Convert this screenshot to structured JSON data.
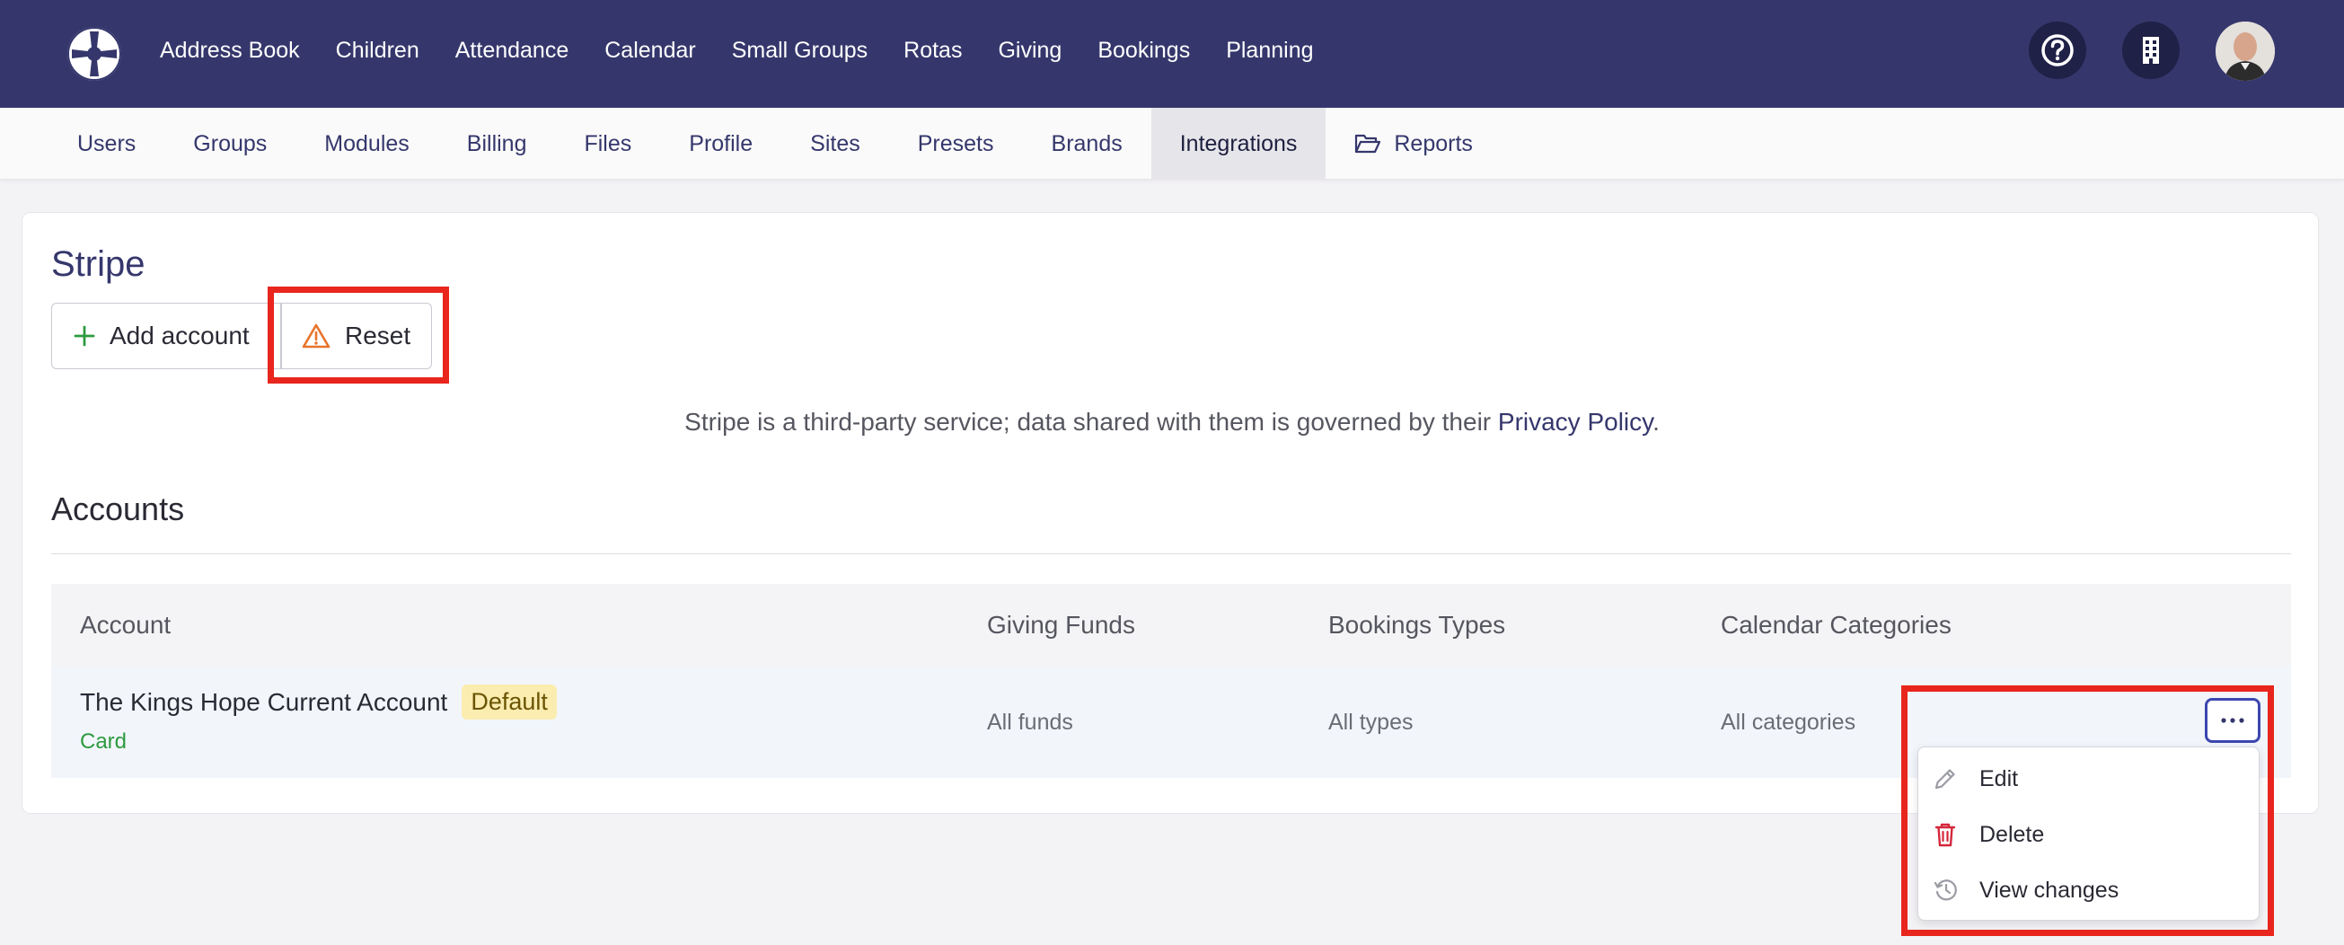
{
  "nav": {
    "items": [
      "Address Book",
      "Children",
      "Attendance",
      "Calendar",
      "Small Groups",
      "Rotas",
      "Giving",
      "Bookings",
      "Planning"
    ],
    "icons": [
      "help-icon",
      "building-icon"
    ]
  },
  "subnav": {
    "tabs": [
      "Users",
      "Groups",
      "Modules",
      "Billing",
      "Files",
      "Profile",
      "Sites",
      "Presets",
      "Brands",
      "Integrations",
      "Reports"
    ],
    "active": "Integrations"
  },
  "page": {
    "title": "Stripe",
    "add_label": "Add account",
    "reset_label": "Reset",
    "note_text": "Stripe is a third-party service; data shared with them is governed by their ",
    "note_link": "Privacy Policy",
    "note_end": "."
  },
  "accounts": {
    "heading": "Accounts",
    "columns": [
      "Account",
      "Giving Funds",
      "Bookings Types",
      "Calendar Categories"
    ],
    "rows": [
      {
        "name": "The Kings Hope Current Account",
        "badge": "Default",
        "type": "Card",
        "funds": "All funds",
        "types": "All types",
        "categories": "All categories"
      }
    ]
  },
  "menu": {
    "items": [
      "Edit",
      "Delete",
      "View changes"
    ]
  },
  "colors": {
    "brand": "#35376c",
    "highlight": "#e8261d",
    "success": "#2e9a3f",
    "danger": "#d4273a",
    "warning": "#e8742b"
  }
}
